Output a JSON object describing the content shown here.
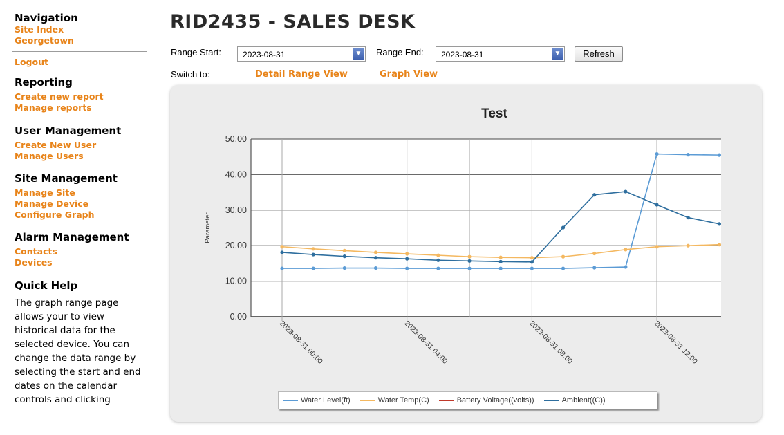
{
  "sidebar": {
    "navigation": {
      "title": "Navigation",
      "links": [
        "Site Index",
        "Georgetown"
      ],
      "logout": "Logout"
    },
    "reporting": {
      "title": "Reporting",
      "links": [
        "Create new report",
        "Manage reports"
      ]
    },
    "user_management": {
      "title": "User Management",
      "links": [
        "Create New User",
        "Manage Users"
      ]
    },
    "site_management": {
      "title": "Site Management",
      "links": [
        "Manage Site",
        "Manage Device",
        "Configure Graph"
      ]
    },
    "alarm_management": {
      "title": "Alarm Management",
      "links": [
        "Contacts",
        "Devices"
      ]
    },
    "quick_help": {
      "title": "Quick Help",
      "text": "The graph range page allows your to view historical data for the selected device. You can change the data range by selecting the start and end dates on the calendar controls and clicking"
    }
  },
  "header": {
    "title": "RID2435 - SALES DESK"
  },
  "range": {
    "start_label": "Range Start:",
    "start_value": "2023-08-31",
    "end_label": "Range End:",
    "end_value": "2023-08-31",
    "refresh_label": "Refresh"
  },
  "switch": {
    "label": "Switch to:",
    "links": [
      "Detail Range View",
      "Graph View"
    ]
  },
  "colors": {
    "link": "#e8841a",
    "water_level": "#5b9bd5",
    "water_temp": "#f4b860",
    "battery_voltage": "#c0392b",
    "ambient": "#2e6e9e"
  },
  "chart_data": {
    "type": "line",
    "title": "Test",
    "ylabel": "Parameter",
    "xlabel": "",
    "ylim": [
      0,
      50
    ],
    "yticks": [
      "0.00",
      "10.00",
      "20.00",
      "30.00",
      "40.00",
      "50.00"
    ],
    "xlim": [
      0,
      14
    ],
    "xticks": [
      {
        "x": 0,
        "label": "2023-08-31 00:00"
      },
      {
        "x": 4,
        "label": "2023-08-31 04:00"
      },
      {
        "x": 8,
        "label": "2023-08-31 08:00"
      },
      {
        "x": 12,
        "label": "2023-08-31 12:00"
      }
    ],
    "x": [
      0,
      1,
      2,
      3,
      4,
      5,
      6,
      7,
      8,
      9,
      10,
      11,
      12,
      13,
      14
    ],
    "series": [
      {
        "name": "Water Level(ft)",
        "color": "#5b9bd5",
        "values": [
          13.6,
          13.6,
          13.7,
          13.7,
          13.6,
          13.6,
          13.6,
          13.6,
          13.6,
          13.6,
          13.8,
          14.0,
          45.8,
          45.6,
          45.5
        ]
      },
      {
        "name": "Water Temp(C)",
        "color": "#f4b860",
        "values": [
          19.7,
          19.1,
          18.6,
          18.1,
          17.7,
          17.3,
          16.9,
          16.7,
          16.6,
          16.9,
          17.8,
          18.9,
          19.7,
          20.0,
          20.3
        ]
      },
      {
        "name": "Battery Voltage((volts))",
        "color": "#c0392b",
        "values": []
      },
      {
        "name": "Ambient((C))",
        "color": "#2e6e9e",
        "values": [
          18.1,
          17.5,
          17.0,
          16.6,
          16.3,
          15.9,
          15.7,
          15.5,
          15.4,
          25.1,
          34.3,
          35.2,
          31.5,
          27.9,
          26.1
        ]
      }
    ]
  }
}
